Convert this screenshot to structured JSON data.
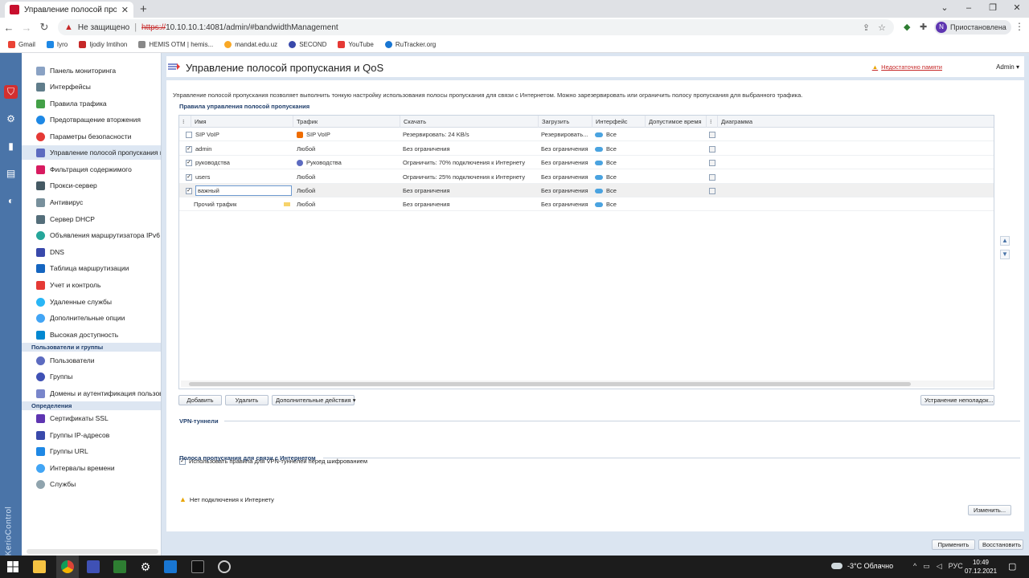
{
  "browser": {
    "tab_title": "Управление полосой пропуска",
    "not_secure": "Не защищено",
    "url_scheme": "https://",
    "url_rest": "10.10.10.1:4081/admin/#bandwidthManagement",
    "profile_initial": "N",
    "profile_label": "Приостановлена",
    "bookmarks": [
      "Gmail",
      "Iyro",
      "Ijodiy Imtihon",
      "HEMIS OTM | hemis...",
      "mandat.edu.uz",
      "SECOND",
      "YouTube",
      "RuTracker.org"
    ]
  },
  "sidebar": {
    "items": [
      "Панель мониторинга",
      "Интерфейсы",
      "Правила трафика",
      "Предотвращение вторжения",
      "Параметры безопасности",
      "Управление полосой пропускания и QoS",
      "Фильтрация содержимого",
      "Прокси-сервер",
      "Антивирус",
      "Сервер DHCP",
      "Объявления маршрутизатора IPv6",
      "DNS",
      "Таблица маршрутизации",
      "Учет и контроль",
      "Удаленные службы",
      "Дополнительные опции",
      "Высокая доступность"
    ],
    "section_users": "Пользователи и группы",
    "users_items": [
      "Пользователи",
      "Группы",
      "Домены и аутентификация пользователей"
    ],
    "section_defs": "Определения",
    "defs_items": [
      "Сертификаты SSL",
      "Группы IP-адресов",
      "Группы URL",
      "Интервалы времени",
      "Службы"
    ]
  },
  "header": {
    "title": "Управление полосой пропускания и QoS",
    "low_memory": "Недостаточно памяти",
    "admin": "Admin"
  },
  "content": {
    "description": "Управление полосой пропускания позволяет выполнить тонкую настройку использования полосы пропускания для связи с Интернетом. Можно зарезервировать или ограничить полосу пропускания для выбранного трафика.",
    "rules_title": "Правила управления полосой пропускания",
    "columns": [
      "Имя",
      "Трафик",
      "Скачать",
      "Загрузить",
      "Интерфейс",
      "Допустимое время",
      "Диаграмма"
    ],
    "rows": [
      {
        "checked": false,
        "name": "SIP VoIP",
        "traffic": "SIP VoIP",
        "download": "Резервировать: 24 KB/s",
        "upload": "Резервировать...",
        "iface": "Все"
      },
      {
        "checked": true,
        "name": "admin",
        "traffic": "Любой",
        "download": "Без ограничения",
        "upload": "Без ограничения",
        "iface": "Все"
      },
      {
        "checked": true,
        "name": "руководства",
        "traffic": "Руководства",
        "download": "Ограничить: 70% подключения к Интернету",
        "upload": "Без ограничения",
        "iface": "Все"
      },
      {
        "checked": true,
        "name": "users",
        "traffic": "Любой",
        "download": "Ограничить: 25% подключения к Интернету",
        "upload": "Без ограничения",
        "iface": "Все"
      },
      {
        "checked": true,
        "name": "важный",
        "traffic": "Любой",
        "download": "Без ограничения",
        "upload": "Без ограничения",
        "iface": "Все"
      },
      {
        "checked": null,
        "name": "Прочий трафик",
        "traffic": "Любой",
        "download": "Без ограничения",
        "upload": "Без ограничения",
        "iface": "Все"
      }
    ],
    "btn_add": "Добавить",
    "btn_delete": "Удалить",
    "btn_more": "Дополнительные действия",
    "btn_troubleshoot": "Устранение неполадок...",
    "vpn_title": "VPN-туннели",
    "vpn_check_label": "Использовать правила для VPN-туннелей перед шифрованием",
    "bw_title": "Полоса пропускания для связи с Интернетом",
    "no_internet": "Нет подключения к Интернету",
    "btn_change": "Изменить..."
  },
  "footer": {
    "apply": "Применить",
    "restore": "Восстановить"
  },
  "taskbar": {
    "weather": "-3°C  Облачно",
    "lang": "РУС",
    "time": "10:49",
    "date": "07.12.2021"
  },
  "brand": {
    "side_label": "KerioControl",
    "accent": "#4a74a8",
    "link_red": "#c62828"
  }
}
